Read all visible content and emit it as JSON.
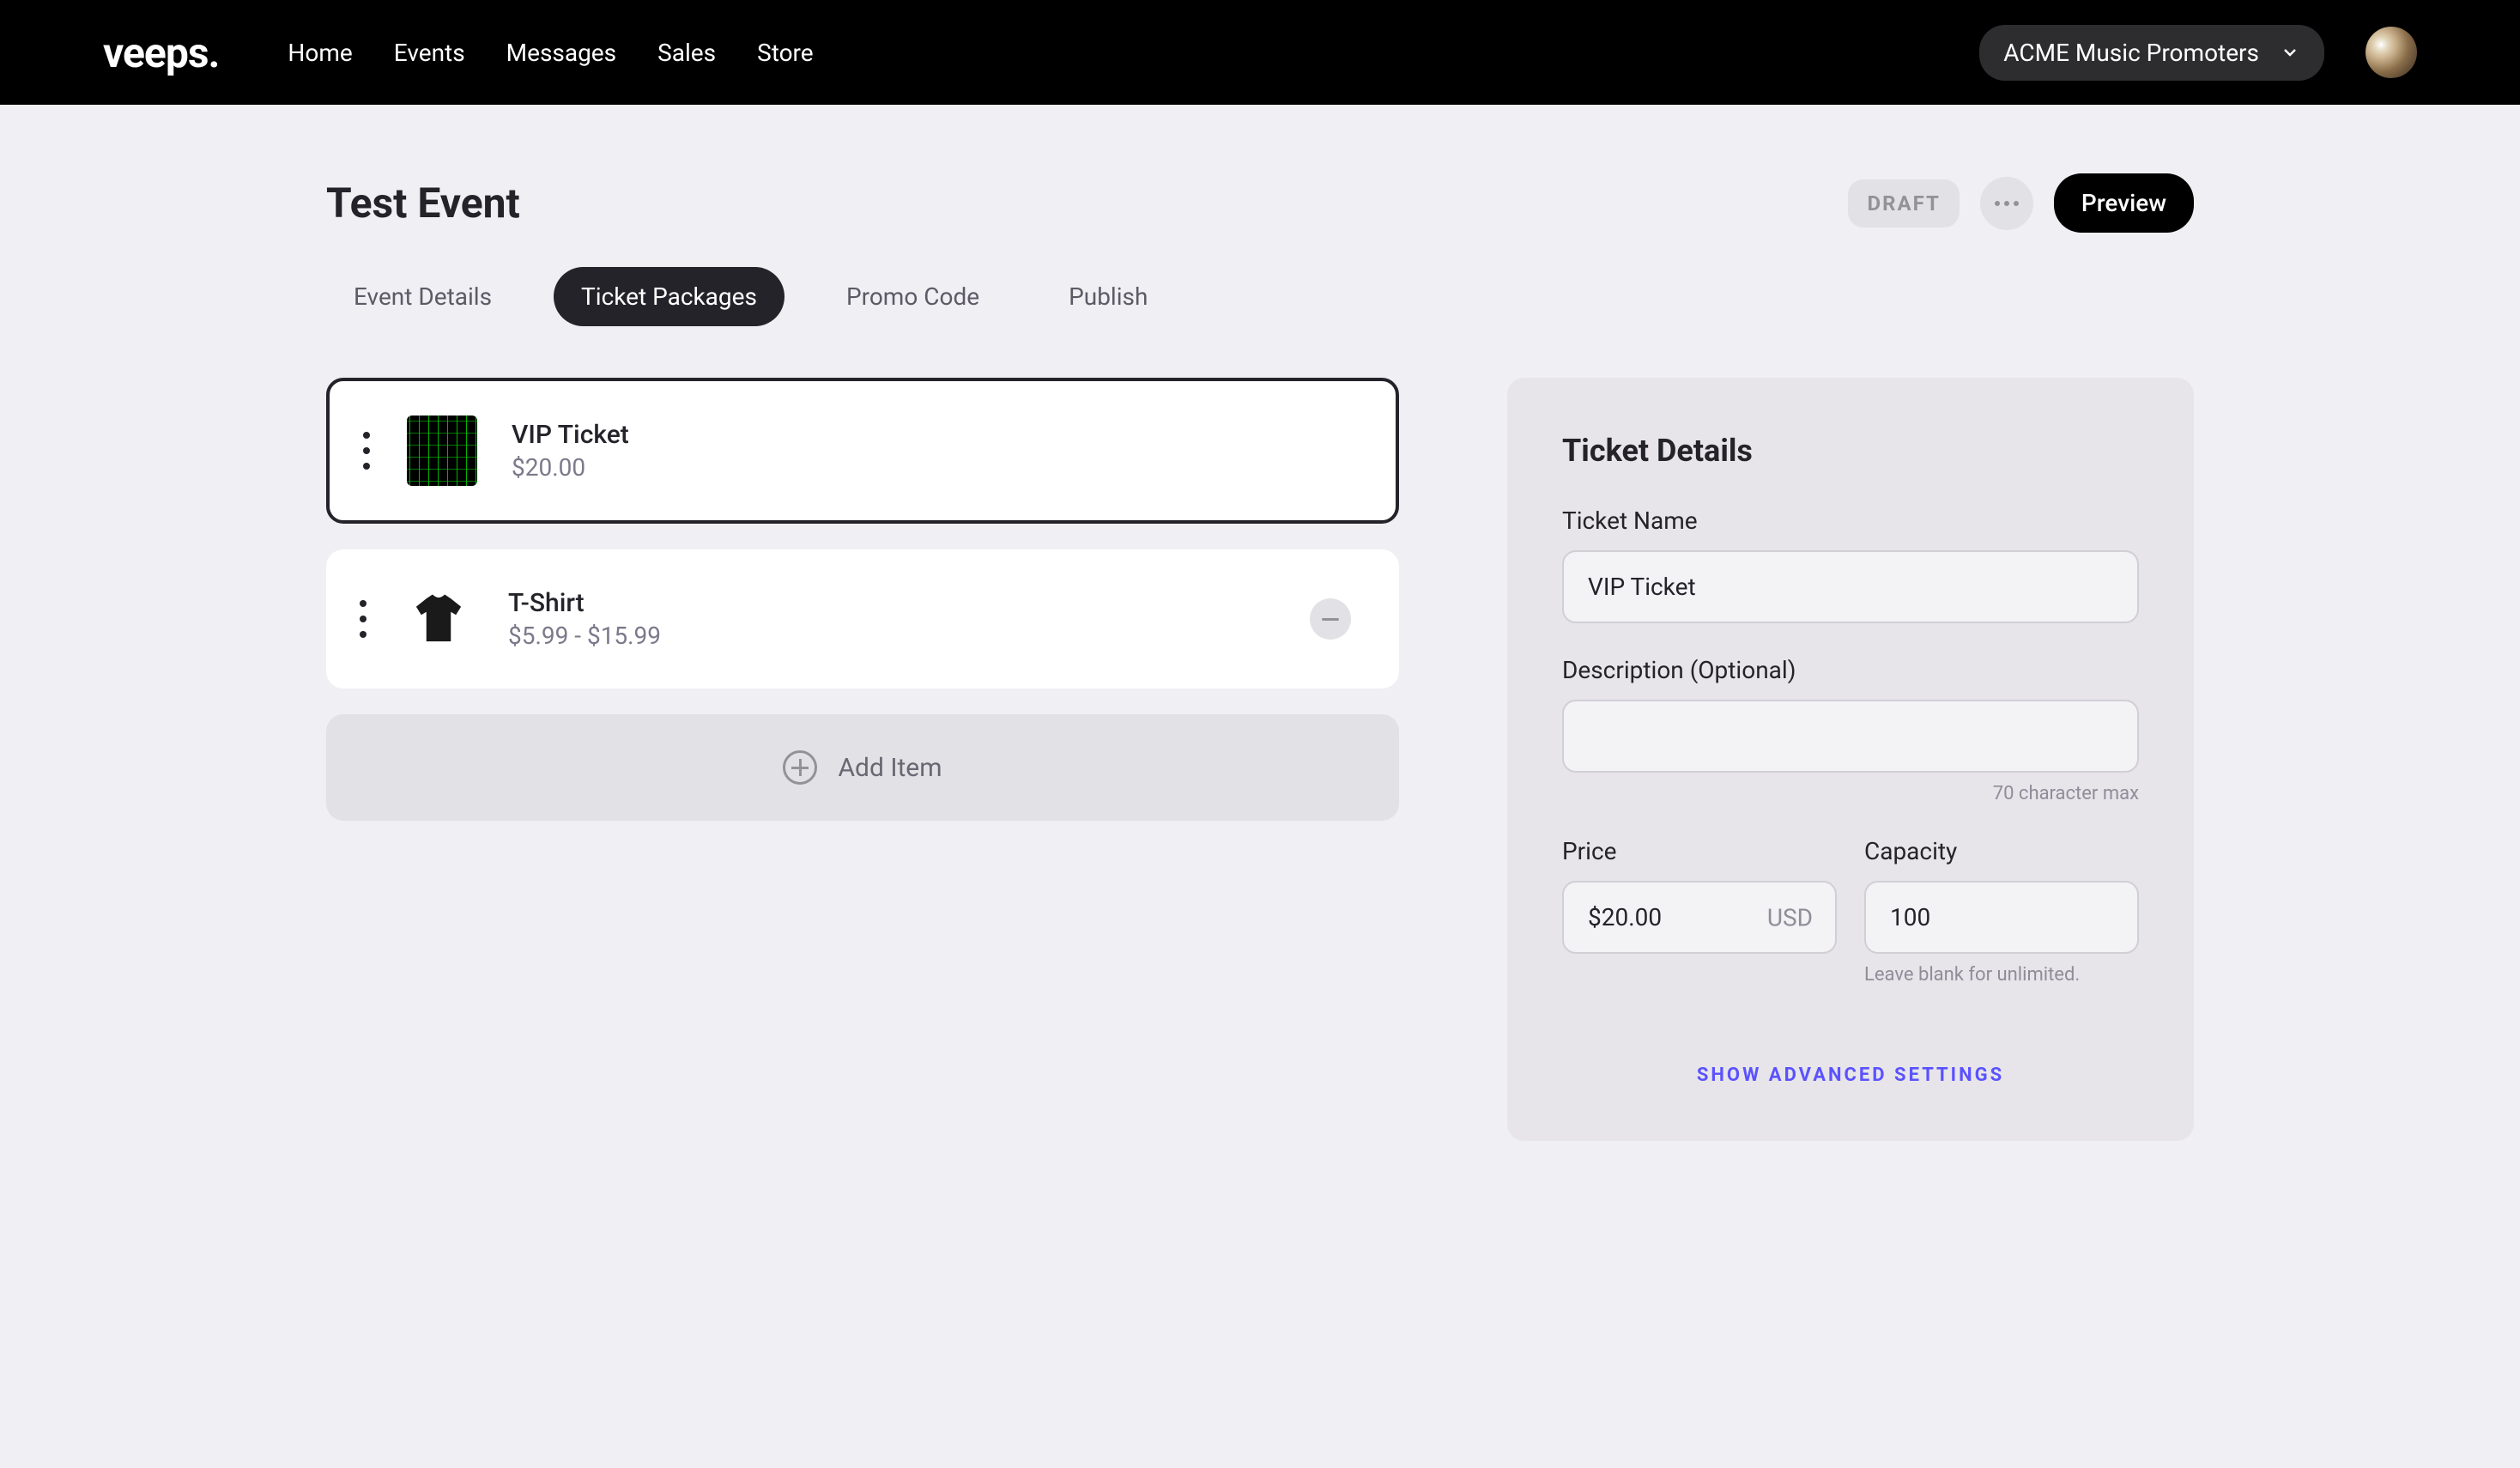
{
  "header": {
    "logo": "veeps.",
    "nav": [
      {
        "label": "Home"
      },
      {
        "label": "Events"
      },
      {
        "label": "Messages"
      },
      {
        "label": "Sales"
      },
      {
        "label": "Store"
      }
    ],
    "org_selector": "ACME Music Promoters"
  },
  "page": {
    "title": "Test Event",
    "draft_badge": "DRAFT",
    "preview_button": "Preview"
  },
  "tabs": [
    {
      "label": "Event Details",
      "active": false
    },
    {
      "label": "Ticket Packages",
      "active": true
    },
    {
      "label": "Promo Code",
      "active": false
    },
    {
      "label": "Publish",
      "active": false
    }
  ],
  "packages": [
    {
      "name": "VIP Ticket",
      "price": "$20.00",
      "selected": true
    },
    {
      "name": "T-Shirt",
      "price": "$5.99 - $15.99",
      "selected": false
    }
  ],
  "add_item": "Add Item",
  "details": {
    "title": "Ticket Details",
    "ticket_name_label": "Ticket Name",
    "ticket_name_value": "VIP Ticket",
    "description_label": "Description (Optional)",
    "description_value": "",
    "description_hint": "70 character max",
    "price_label": "Price",
    "price_value": "$20.00",
    "price_currency": "USD",
    "capacity_label": "Capacity",
    "capacity_value": "100",
    "capacity_hint": "Leave blank for unlimited.",
    "advanced_link": "SHOW ADVANCED SETTINGS"
  }
}
